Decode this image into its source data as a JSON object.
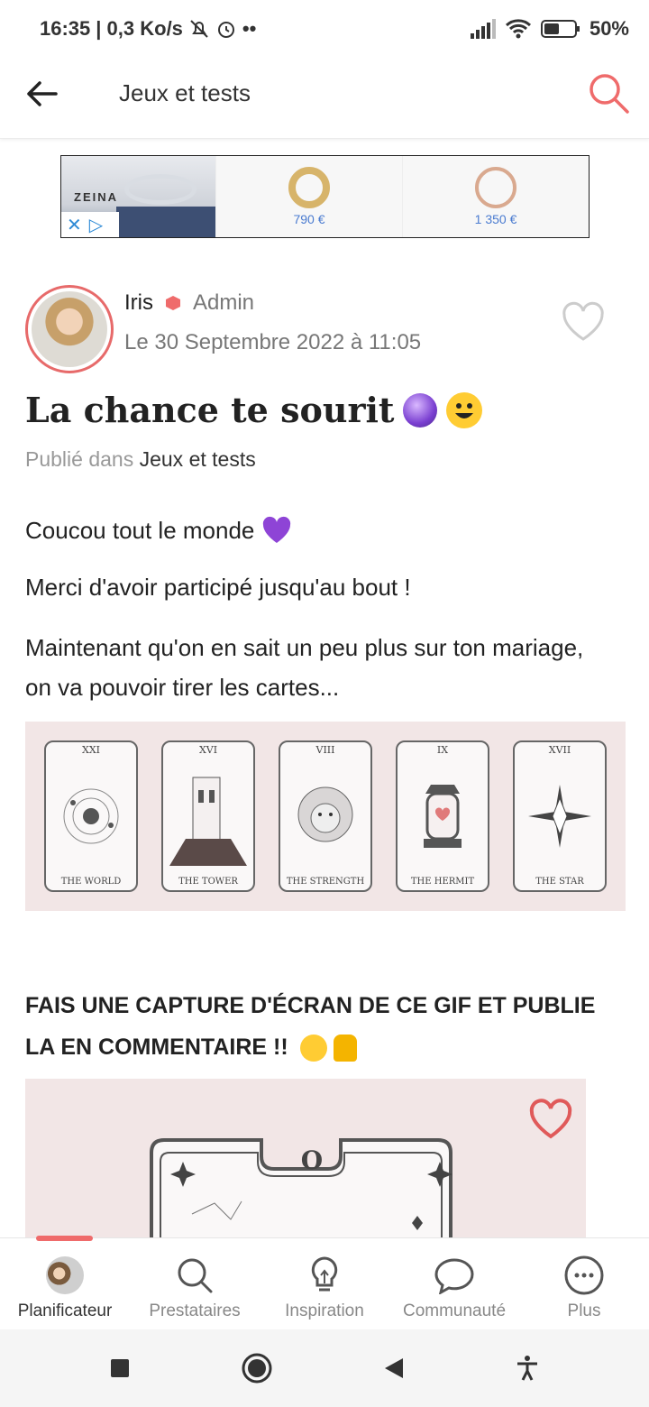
{
  "status_bar": {
    "time": "16:35",
    "speed": "| 0,3 Ko/s",
    "battery": "50%"
  },
  "appbar": {
    "title": "Jeux et tests"
  },
  "ad": {
    "brand": "ZEINA",
    "products": [
      {
        "price": "790 €"
      },
      {
        "price": "1 350 €"
      }
    ]
  },
  "post": {
    "author": "Iris",
    "role": "Admin",
    "date": "Le 30 Septembre 2022 à 11:05",
    "title": "La chance te sourit",
    "posted_label": "Publié dans",
    "category": "Jeux et tests",
    "paragraphs": [
      "Coucou tout le monde",
      "Merci d'avoir participé jusqu'au bout !",
      "Maintenant qu'on en sait un peu plus sur ton mariage, on va pouvoir tirer les cartes..."
    ],
    "tarot_cards": [
      {
        "num": "XXI",
        "label": "THE WORLD"
      },
      {
        "num": "XVI",
        "label": "THE TOWER"
      },
      {
        "num": "VIII",
        "label": "THE STRENGTH"
      },
      {
        "num": "IX",
        "label": "THE HERMIT"
      },
      {
        "num": "XVII",
        "label": "THE STAR"
      }
    ],
    "call_to_action": "FAIS UNE CAPTURE D'ÉCRAN DE CE GIF ET PUBLIE LA EN COMMENTAIRE !!",
    "gif_card_num": "O"
  },
  "bottom_nav": {
    "items": [
      {
        "label": "Planificateur"
      },
      {
        "label": "Prestataires"
      },
      {
        "label": "Inspiration"
      },
      {
        "label": "Communauté"
      },
      {
        "label": "Plus"
      }
    ]
  },
  "colors": {
    "accent": "#ef6b6b",
    "panel": "#f2e6e6"
  }
}
